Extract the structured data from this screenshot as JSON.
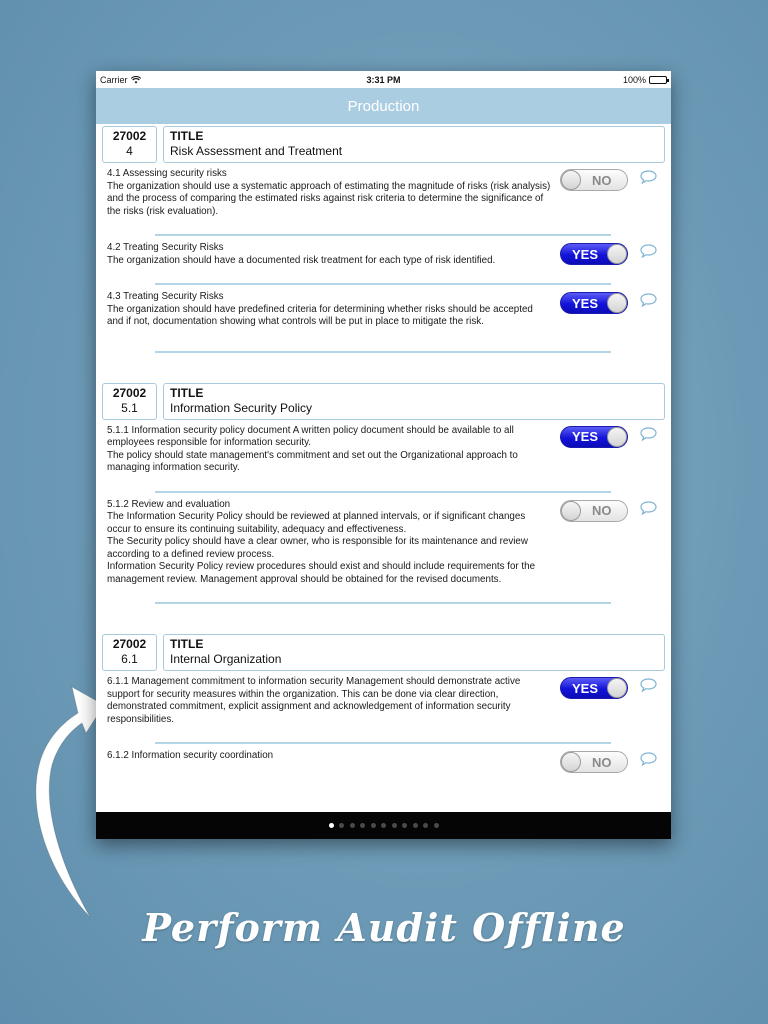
{
  "status_bar": {
    "carrier": "Carrier",
    "time": "3:31 PM",
    "battery": "100%",
    "wifi_icon": "wifi-icon",
    "battery_icon": "battery-icon"
  },
  "navbar": {
    "title": "Production"
  },
  "colors": {
    "navbar": "#abcde2",
    "toggle_on": "#1313d9",
    "border": "#a7cadd",
    "background": "#6c9ab6"
  },
  "sections": [
    {
      "standard": "27002",
      "number": "4",
      "title_label": "TITLE",
      "title": "Risk Assessment and Treatment",
      "items": [
        {
          "text": "4.1  Assessing security risks\nThe organization should use a systematic approach of estimating the magnitude of risks (risk analysis) and the process of comparing the estimated risks against risk criteria to determine the significance of the risks (risk evaluation).",
          "answer": "NO",
          "on": false
        },
        {
          "text": "4.2  Treating Security Risks\nThe organization should have a documented risk treatment for each type of risk identified.",
          "answer": "YES",
          "on": true
        },
        {
          "text": "4.3  Treating Security Risks\nThe organization should have predefined criteria for determining whether risks should be accepted and if not, documentation showing what controls will be put in place to mitigate the risk.",
          "answer": "YES",
          "on": true
        }
      ]
    },
    {
      "standard": "27002",
      "number": "5.1",
      "title_label": "TITLE",
      "title": "Information Security Policy",
      "items": [
        {
          "text": "5.1.1 Information security policy document A written policy document should be available to all employees responsible for information security.\nThe policy should state management's commitment and set out the Organizational approach to managing information security.",
          "answer": "YES",
          "on": true
        },
        {
          "text": "5.1.2 Review and evaluation\nThe Information Security Policy should be reviewed at planned intervals, or if significant changes occur to ensure its continuing suitability, adequacy and effectiveness.\nThe Security policy should have a clear owner, who is responsible for its maintenance and review according to a defined review process.\nInformation Security Policy review procedures should exist and should include requirements for the management review. Management approval should be obtained for the revised documents.",
          "answer": "NO",
          "on": false
        }
      ]
    },
    {
      "standard": "27002",
      "number": "6.1",
      "title_label": "TITLE",
      "title": "Internal Organization",
      "items": [
        {
          "text": "6.1.1 Management commitment to information security Management should demonstrate active support for security measures within the organization. This can be done via clear direction, demonstrated commitment, explicit assignment and acknowledgement of information security responsibilities.",
          "answer": "YES",
          "on": true
        },
        {
          "text": "6.1.2 Information security coordination",
          "answer": "NO",
          "on": false
        }
      ]
    }
  ],
  "pager": {
    "total_pages": 11,
    "current_page": 1
  },
  "caption": "Perform Audit Offline"
}
